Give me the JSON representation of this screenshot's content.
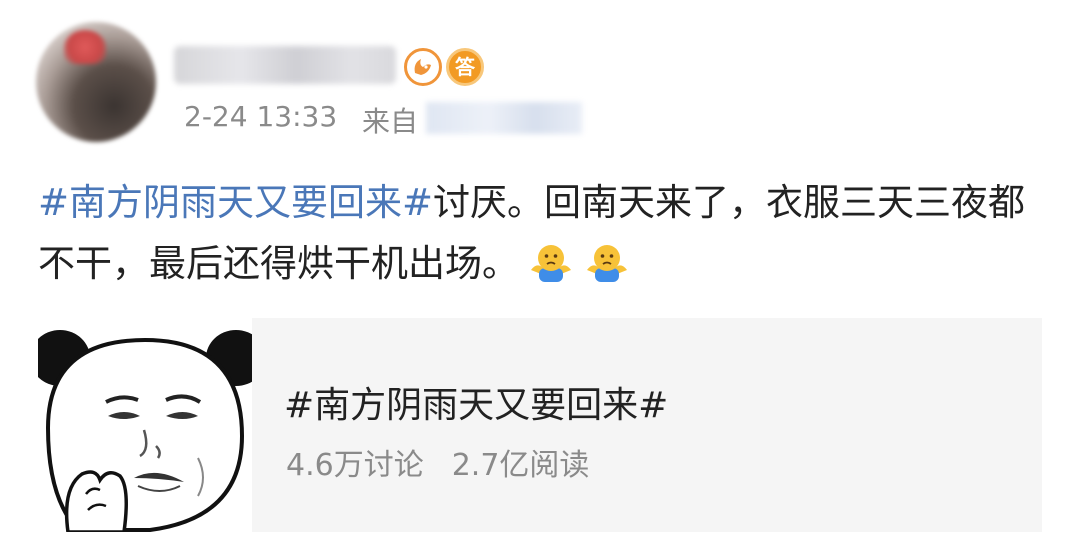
{
  "header": {
    "timestamp": "2-24 13:33",
    "source_prefix": "来自",
    "badges": [
      {
        "icon": "fox-badge-icon"
      },
      {
        "icon": "answer-badge-icon",
        "text": "答"
      }
    ]
  },
  "post": {
    "topic": "#南方阴雨天又要回来#",
    "text": "讨厌。回南天来了，衣服三天三夜都不干，最后还得烘干机出场。",
    "emojis": [
      "shrug-emoji-icon",
      "shrug-emoji-icon"
    ]
  },
  "card": {
    "title": "#南方阴雨天又要回来#",
    "discussions": "4.6万讨论",
    "reads": "2.7亿阅读"
  },
  "colors": {
    "topic_link": "#4a77b8",
    "meta_gray": "#8a8a8a",
    "card_bg": "#f5f5f5",
    "badge_orange": "#f29a23"
  }
}
